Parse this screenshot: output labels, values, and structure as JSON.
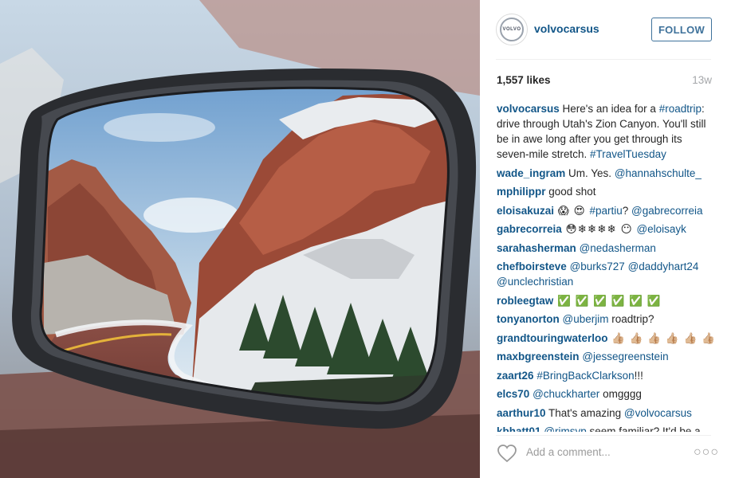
{
  "post": {
    "username": "volvocarsus",
    "avatar_text": "VOLVO",
    "follow_label": "FOLLOW",
    "likes": "1,557 likes",
    "age": "13w",
    "add_comment_placeholder": "Add a comment...",
    "more_label": "○○○"
  },
  "colors": {
    "username_blue": "#125688",
    "follow_blue": "#3f729b",
    "muted_gray": "#a5a7aa"
  },
  "caption": {
    "user": "volvocarsus",
    "t1": " Here's an idea for a ",
    "tag1": "#roadtrip",
    "t2": ": drive through Utah's Zion Canyon. You'll still be in awe long after you get through its seven-mile stretch. ",
    "tag2": "#TravelTuesday"
  },
  "comments": [
    {
      "user": "wade_ingram",
      "t1": " Um. Yes. ",
      "link1": "@hannahschulte_"
    },
    {
      "user": "mphilippr",
      "t1": " good shot"
    },
    {
      "user": "eloisakuzai",
      "t1": " 😱 😍  ",
      "link1": "#partiu",
      "t2": "? ",
      "link2": "@gabrecorreia"
    },
    {
      "user": "gabrecorreia",
      "t1": " 😳❄❄❄❄ 😶 ",
      "link1": "@eloisayk"
    },
    {
      "user": "sarahasherman",
      "t1": " ",
      "link1": "@nedasherman"
    },
    {
      "user": "chefboirsteve",
      "t1": " ",
      "link1": "@burks727",
      "t2": " ",
      "link2": "@daddyhart24",
      "t3": " ",
      "link3": "@unclechristian"
    },
    {
      "user": "robleegtaw",
      "t1": " ✅ ✅ ✅ ✅ ✅ ✅"
    },
    {
      "user": "tonyanorton",
      "t1": " ",
      "link1": "@uberjim",
      "t2": " roadtrip?"
    },
    {
      "user": "grandtouringwaterloo",
      "t1": " 👍🏼 👍🏼 👍🏼 👍🏼 👍🏼 👍🏼"
    },
    {
      "user": "maxbgreenstein",
      "t1": " ",
      "link1": "@jessegreenstein"
    },
    {
      "user": "zaart26",
      "t1": " ",
      "link1": "#BringBackClarkson",
      "t2": "!!!"
    },
    {
      "user": "elcs70",
      "t1": " ",
      "link1": "@chuckharter",
      "t2": " omgggg"
    },
    {
      "user": "aarthur10",
      "t1": " That's amazing ",
      "link1": "@volvocarsus"
    },
    {
      "user": "kbhatt01",
      "t1": " ",
      "link1": "@rimsyp",
      "t2": " seem familiar? It'd be a"
    }
  ],
  "icons": {
    "heart": "heart-icon",
    "more": "more-options-icon",
    "logo": "volvo-logo-icon"
  }
}
